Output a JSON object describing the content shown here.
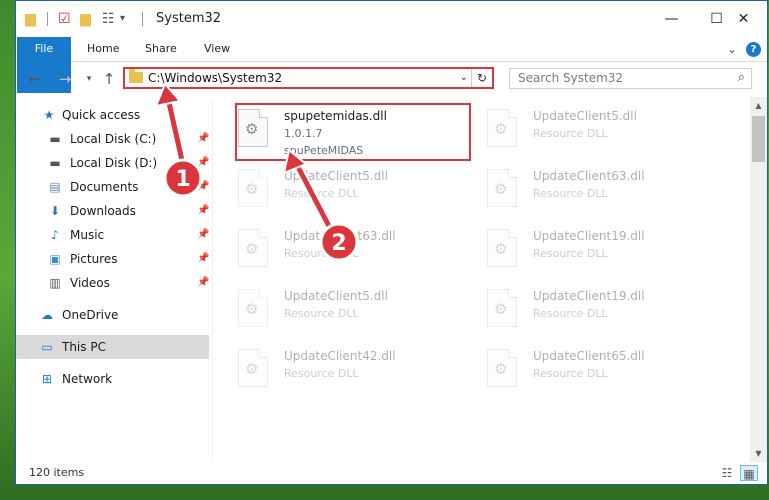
{
  "window": {
    "title": "System32",
    "controls": {
      "minimize": "—",
      "maximize": "☐",
      "close": "✕"
    }
  },
  "ribbon": {
    "tabs": [
      "File",
      "Home",
      "Share",
      "View"
    ],
    "expand": "⌄",
    "help": "?"
  },
  "nav": {
    "address": "C:\\Windows\\System32",
    "search_placeholder": "Search System32"
  },
  "sidebar": {
    "items": [
      {
        "label": "Quick access",
        "icon": "star-icon"
      },
      {
        "label": "Local Disk (C:)",
        "icon": "drive-icon",
        "pinned": true
      },
      {
        "label": "Local Disk (D:)",
        "icon": "drive-icon",
        "pinned": true
      },
      {
        "label": "Documents",
        "icon": "documents-icon",
        "pinned": true
      },
      {
        "label": "Downloads",
        "icon": "download-icon",
        "pinned": true
      },
      {
        "label": "Music",
        "icon": "music-icon",
        "pinned": true
      },
      {
        "label": "Pictures",
        "icon": "pictures-icon",
        "pinned": true
      },
      {
        "label": "Videos",
        "icon": "videos-icon",
        "pinned": true
      },
      {
        "label": "OneDrive",
        "icon": "cloud-icon"
      },
      {
        "label": "This PC",
        "icon": "computer-icon",
        "selected": true
      },
      {
        "label": "Network",
        "icon": "network-icon"
      }
    ]
  },
  "files": [
    {
      "name": "spupetemidas.dll",
      "line2": "1.0.1.7",
      "line3": "spuPeteMIDAS",
      "highlighted": true
    },
    {
      "name": "UpdateClient5.dll",
      "line2": "Resource DLL"
    },
    {
      "name": "UpdateClient5.dll",
      "line2": "Resource DLL"
    },
    {
      "name": "UpdateClient63.dll",
      "line2": "Resource DLL"
    },
    {
      "name": "UpdateClient63.dll",
      "line2": "Resource DLL"
    },
    {
      "name": "UpdateClient19.dll",
      "line2": "Resource DLL"
    },
    {
      "name": "UpdateClient5.dll",
      "line2": "Resource DLL"
    },
    {
      "name": "UpdateClient19.dll",
      "line2": "Resource DLL"
    },
    {
      "name": "UpdateClient42.dll",
      "line2": "Resource DLL"
    },
    {
      "name": "UpdateClient65.dll",
      "line2": "Resource DLL"
    }
  ],
  "status": {
    "count": "120 items"
  },
  "annotations": {
    "badge1": "1",
    "badge2": "2"
  },
  "colors": {
    "highlight": "#d9363e",
    "accent": "#1979ca",
    "selected": "#d9d9d9"
  }
}
